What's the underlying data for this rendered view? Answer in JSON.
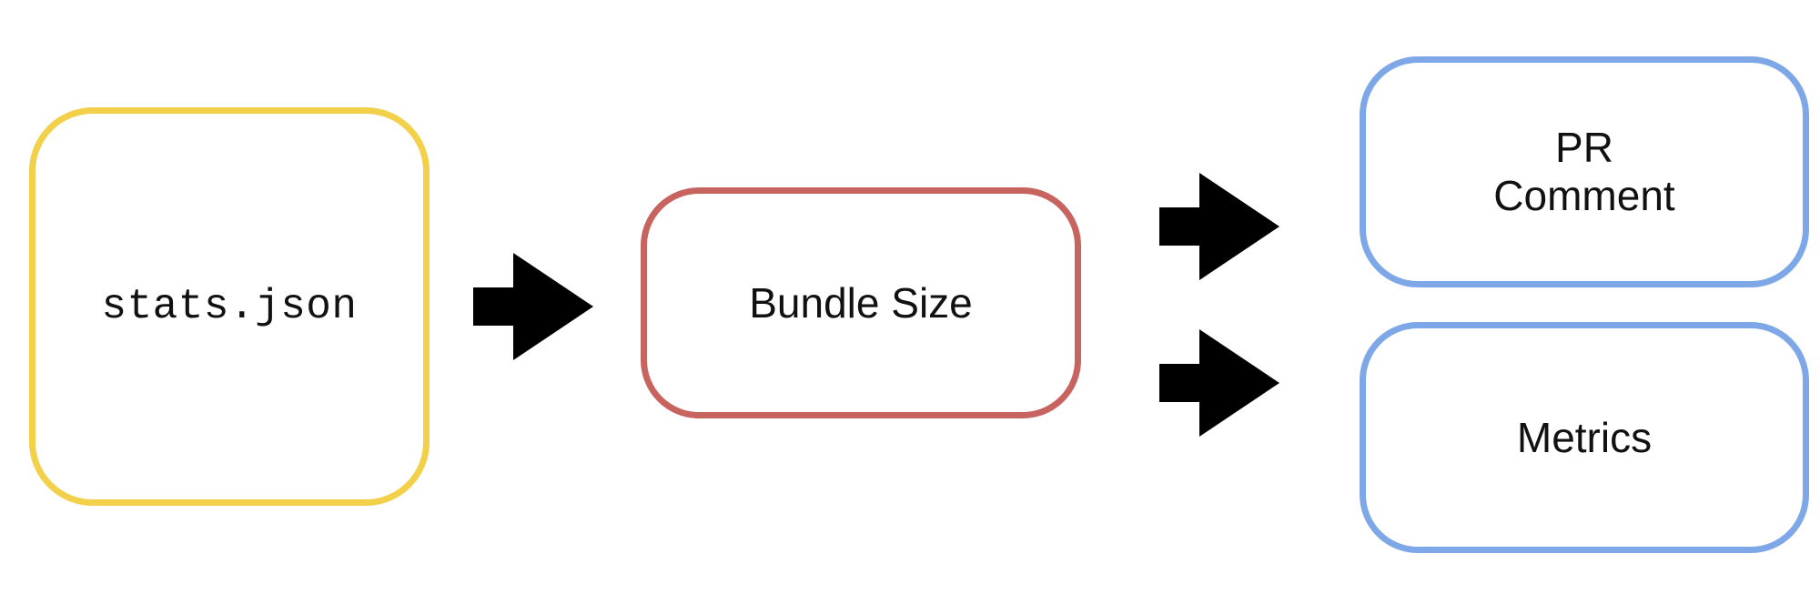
{
  "nodes": {
    "stats": {
      "label": "stats.json",
      "color": "#f2d04a"
    },
    "bundle": {
      "label": "Bundle Size",
      "color": "#c8645f"
    },
    "pr_comment": {
      "label": "PR\nComment",
      "color": "#7ea7e8"
    },
    "metrics": {
      "label": "Metrics",
      "color": "#7ea7e8"
    }
  },
  "arrows": {
    "color": "#000000",
    "icon": "right-arrow-icon"
  }
}
